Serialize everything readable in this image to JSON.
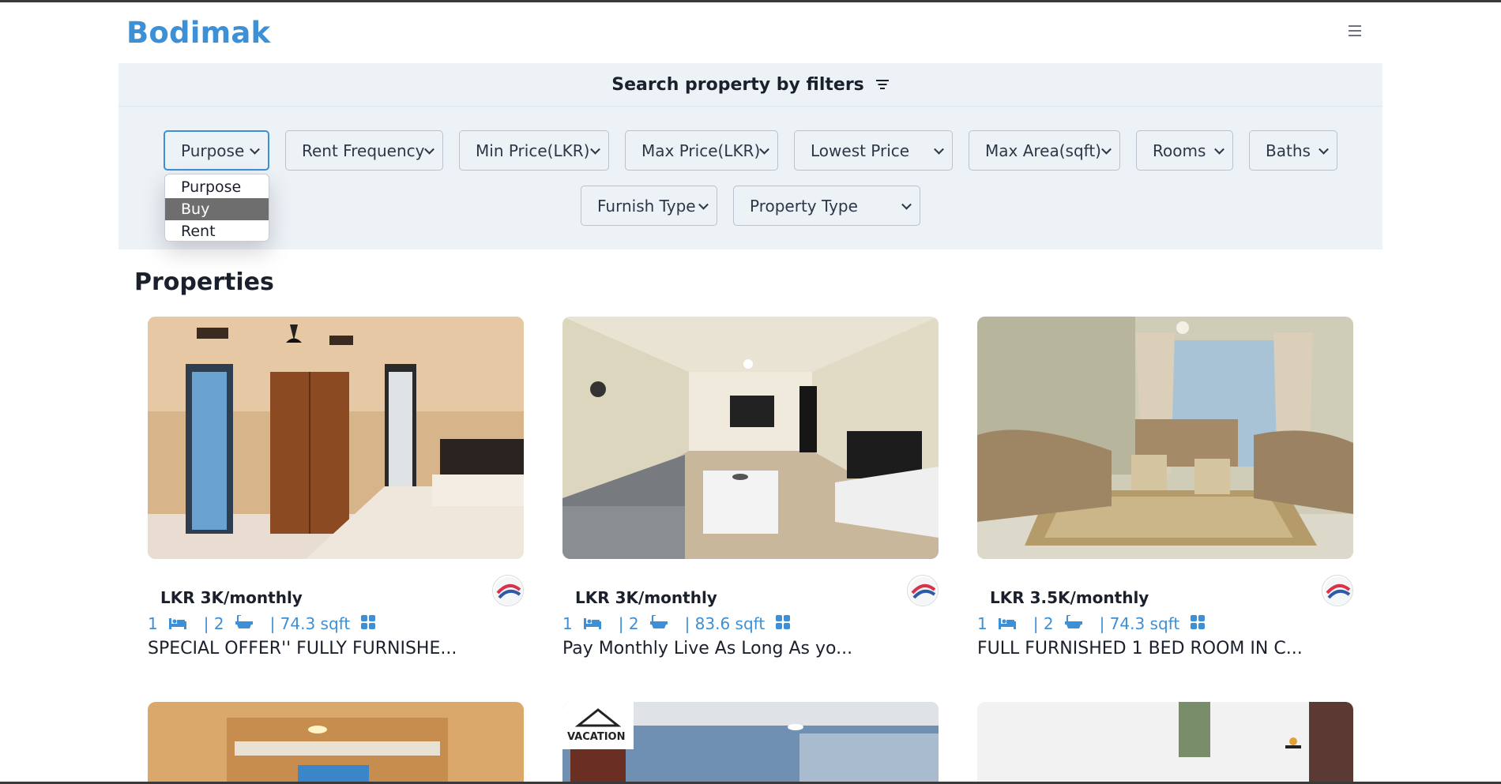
{
  "app": {
    "brand": "Bodimak"
  },
  "filters": {
    "title": "Search property by filters",
    "selects": [
      {
        "label": "Purpose",
        "active": true
      },
      {
        "label": "Rent Frequency"
      },
      {
        "label": "Min Price(LKR)"
      },
      {
        "label": "Max Price(LKR)"
      },
      {
        "label": "Lowest Price"
      },
      {
        "label": "Max Area(sqft)"
      },
      {
        "label": "Rooms"
      },
      {
        "label": "Baths"
      },
      {
        "label": "Furnish Type"
      },
      {
        "label": "Property Type"
      }
    ],
    "dropdown": {
      "options": [
        "Purpose",
        "Buy",
        "Rent"
      ],
      "highlighted": "Buy"
    }
  },
  "properties": {
    "heading": "Properties",
    "cards": [
      {
        "price": "LKR 3K/monthly",
        "rooms": "1",
        "baths": "| 2",
        "area": "| 74.3 sqft",
        "title": "SPECIAL OFFER'' FULLY FURNISHE..."
      },
      {
        "price": "LKR 3K/monthly",
        "rooms": "1",
        "baths": "| 2",
        "area": "| 83.6 sqft",
        "title": "Pay Monthly Live As Long As yo..."
      },
      {
        "price": "LKR 3.5K/monthly",
        "rooms": "1",
        "baths": "| 2",
        "area": "| 74.3 sqft",
        "title": "FULL FURNISHED 1 BED ROOM IN C..."
      }
    ],
    "bottom_row": [
      {
        "badge": "VACATION"
      }
    ]
  },
  "colors": {
    "accent": "#3d8fd6",
    "panel": "#edf2f7",
    "text": "#1a202c"
  },
  "icons": [
    "menu-icon",
    "filter-icon",
    "bed-icon",
    "bath-icon",
    "grid-icon",
    "chevron-down-icon"
  ]
}
